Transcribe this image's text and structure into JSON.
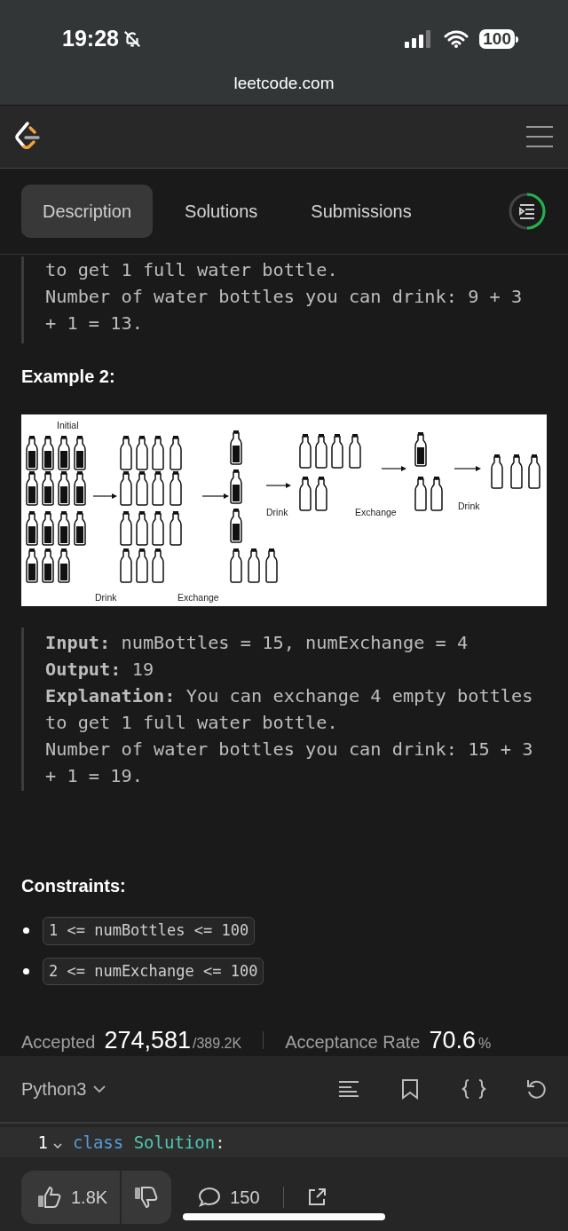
{
  "status_bar": {
    "time": "19:28",
    "battery": "100"
  },
  "browser": {
    "url": "leetcode.com"
  },
  "tabs": [
    {
      "label": "Description",
      "selected": true
    },
    {
      "label": "Solutions",
      "selected": false
    },
    {
      "label": "Submissions",
      "selected": false
    }
  ],
  "example_1_tail": {
    "lines": [
      "to get 1 full water bottle.",
      "Number of water bottles you can drink: 9 + 3",
      "+ 1 = 13."
    ]
  },
  "example_2": {
    "title": "Example 2:",
    "diagram": {
      "labels": [
        "Initial",
        "Drink",
        "Exchange",
        "Drink",
        "Exchange",
        "Drink"
      ]
    },
    "lines": [
      "**Input:** numBottles = 15, numExchange = 4",
      "**Output:** 19",
      "**Explanation:** You can exchange 4 empty bottles",
      "to get 1 full water bottle.",
      "Number of water bottles you can drink: 15 + 3",
      "+ 1 = 19."
    ]
  },
  "constraints": {
    "title": "Constraints:",
    "items": [
      "1 <= numBottles <= 100",
      "2 <= numExchange <= 100"
    ]
  },
  "stats": {
    "accepted_label": "Accepted",
    "accepted": "274,581",
    "submissions": "/389.2K",
    "rate_label": "Acceptance Rate",
    "rate": "70.6",
    "rate_unit": "%"
  },
  "editor": {
    "language": "Python3",
    "lines": [
      {
        "number": "1",
        "code": [
          {
            "kind": "keyword",
            "text": "class"
          },
          {
            "kind": "name",
            "text": "Solution"
          },
          {
            "kind": "plain",
            "text": ":"
          }
        ]
      }
    ]
  },
  "toolbar": {
    "likes": "1.8K",
    "comments": "150"
  }
}
